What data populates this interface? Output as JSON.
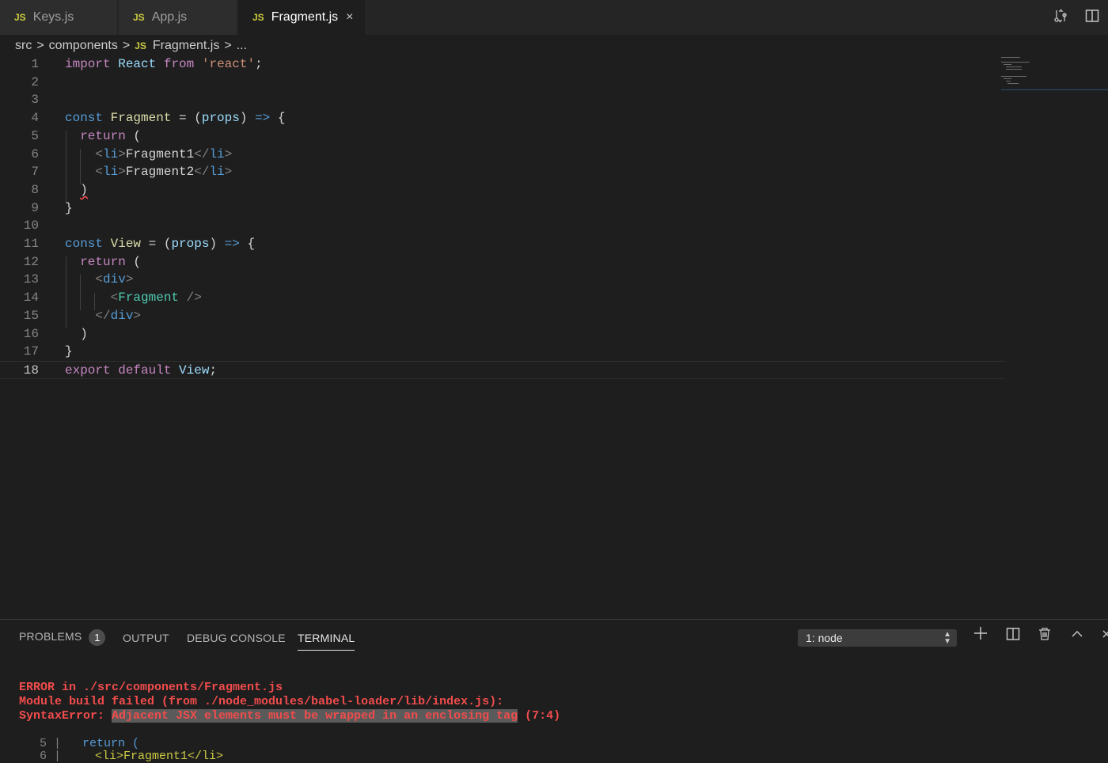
{
  "tabs": [
    {
      "badge": "JS",
      "label": "Keys.js"
    },
    {
      "badge": "JS",
      "label": "App.js"
    },
    {
      "badge": "JS",
      "label": "Fragment.js",
      "close": "×"
    }
  ],
  "breadcrumb": {
    "seg1": "src",
    "seg2": "components",
    "badge": "JS",
    "seg3": "Fragment.js",
    "more": "...",
    "sep": ">"
  },
  "editor": {
    "line_numbers": [
      "1",
      "2",
      "3",
      "4",
      "5",
      "6",
      "7",
      "8",
      "9",
      "10",
      "11",
      "12",
      "13",
      "14",
      "15",
      "16",
      "17",
      "18"
    ],
    "code": {
      "l1": {
        "import": "import",
        "react": "React",
        "from": "from",
        "str": "'react'",
        "semi": ";"
      },
      "l4": {
        "const": "const",
        "name": "Fragment",
        "eq": " = (",
        "props": "props",
        "close": ")",
        "arrow": "=>",
        "brace": "{"
      },
      "l5": {
        "ret": "return",
        "paren": "("
      },
      "l6": {
        "open": "<",
        "tag": "li",
        "gt": ">",
        "text": "Fragment1",
        "close": "</",
        "tag2": "li",
        "gt2": ">"
      },
      "l7": {
        "open": "<",
        "tag": "li",
        "gt": ">",
        "text": "Fragment2",
        "close": "</",
        "tag2": "li",
        "gt2": ">"
      },
      "l8": {
        "paren": ")"
      },
      "l9": {
        "brace": "}"
      },
      "l11": {
        "const": "const",
        "name": "View",
        "eq": " = (",
        "props": "props",
        "close": ")",
        "arrow": "=>",
        "brace": "{"
      },
      "l12": {
        "ret": "return",
        "paren": "("
      },
      "l13": {
        "open": "<",
        "tag": "div",
        "gt": ">"
      },
      "l14": {
        "open": "<",
        "tag": "Fragment",
        "gt": " />"
      },
      "l15": {
        "open": "</",
        "tag": "div",
        "gt": ">"
      },
      "l16": {
        "paren": ")"
      },
      "l17": {
        "brace": "}"
      },
      "l18": {
        "export": "export",
        "default": "default",
        "name": "View",
        "semi": ";"
      }
    }
  },
  "panel": {
    "tabs": {
      "problems": "PROBLEMS",
      "problems_count": "1",
      "output": "OUTPUT",
      "debug": "DEBUG CONSOLE",
      "terminal": "TERMINAL"
    },
    "terminal_select": "1: node",
    "actions": {
      "add": "+",
      "split": "▯",
      "trash": "🗑",
      "maximize": "^",
      "close": "×"
    }
  },
  "terminal": {
    "line1": "ERROR in ./src/components/Fragment.js",
    "line2": "Module build failed (from ./node_modules/babel-loader/lib/index.js):",
    "line3_prefix": "SyntaxError: ",
    "line3_msg": "Adjacent JSX elements must be wrapped in an enclosing tag",
    "line3_pos": " (7:4)",
    "snip1_ln": "5 |",
    "snip1_code": "return (",
    "snip2_ln": "6 |",
    "snip2_code": "<li>Fragment1</li>"
  },
  "colors": {
    "error": "#f14c4c",
    "keyword": "#c586c0",
    "storage": "#569cd6",
    "function": "#dcdcaa",
    "string": "#ce9178",
    "component": "#4ec9b0"
  }
}
